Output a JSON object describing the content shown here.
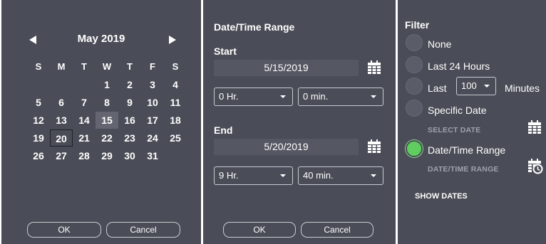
{
  "calendar": {
    "month_title": "May  2019",
    "prev_icon": "triangle-left-icon",
    "next_icon": "triangle-right-icon",
    "weekdays": [
      "S",
      "M",
      "T",
      "W",
      "T",
      "F",
      "S"
    ],
    "weeks": [
      [
        "",
        "",
        "",
        "1",
        "2",
        "3",
        "4"
      ],
      [
        "5",
        "6",
        "7",
        "8",
        "9",
        "10",
        "11"
      ],
      [
        "12",
        "13",
        "14",
        "15",
        "16",
        "17",
        "18"
      ],
      [
        "19",
        "20",
        "21",
        "22",
        "23",
        "24",
        "25"
      ],
      [
        "26",
        "27",
        "28",
        "29",
        "30",
        "31",
        ""
      ]
    ],
    "selected_day": "15",
    "today_day": "20",
    "ok_label": "OK",
    "cancel_label": "Cancel"
  },
  "range": {
    "title": "Date/Time Range",
    "start_label": "Start",
    "start_date": "5/15/2019",
    "start_hour": "0 Hr.",
    "start_min": "0 min.",
    "end_label": "End",
    "end_date": "5/20/2019",
    "end_hour": "9 Hr.",
    "end_min": "40 min.",
    "calendar_icon": "calendar-icon",
    "ok_label": "OK",
    "cancel_label": "Cancel"
  },
  "filter": {
    "title": "Filter",
    "opt_none": "None",
    "opt_last24": "Last 24 Hours",
    "opt_last": "Last",
    "minutes_value": "100",
    "minutes_label": "Minutes",
    "opt_specific": "Specific Date",
    "select_date_label": "SELECT DATE",
    "opt_dtr": "Date/Time Range",
    "dtr_label": "DATE/TIME RANGE",
    "show_dates": "SHOW DATES",
    "selected_option": "Date/Time Range",
    "selected_color": "#5fce5f",
    "clock_calendar_icon": "calendar-clock-icon"
  },
  "colors": {
    "panel_bg": "#4a4d57",
    "field_bg": "#555862",
    "muted_text": "#9fa2ab"
  }
}
